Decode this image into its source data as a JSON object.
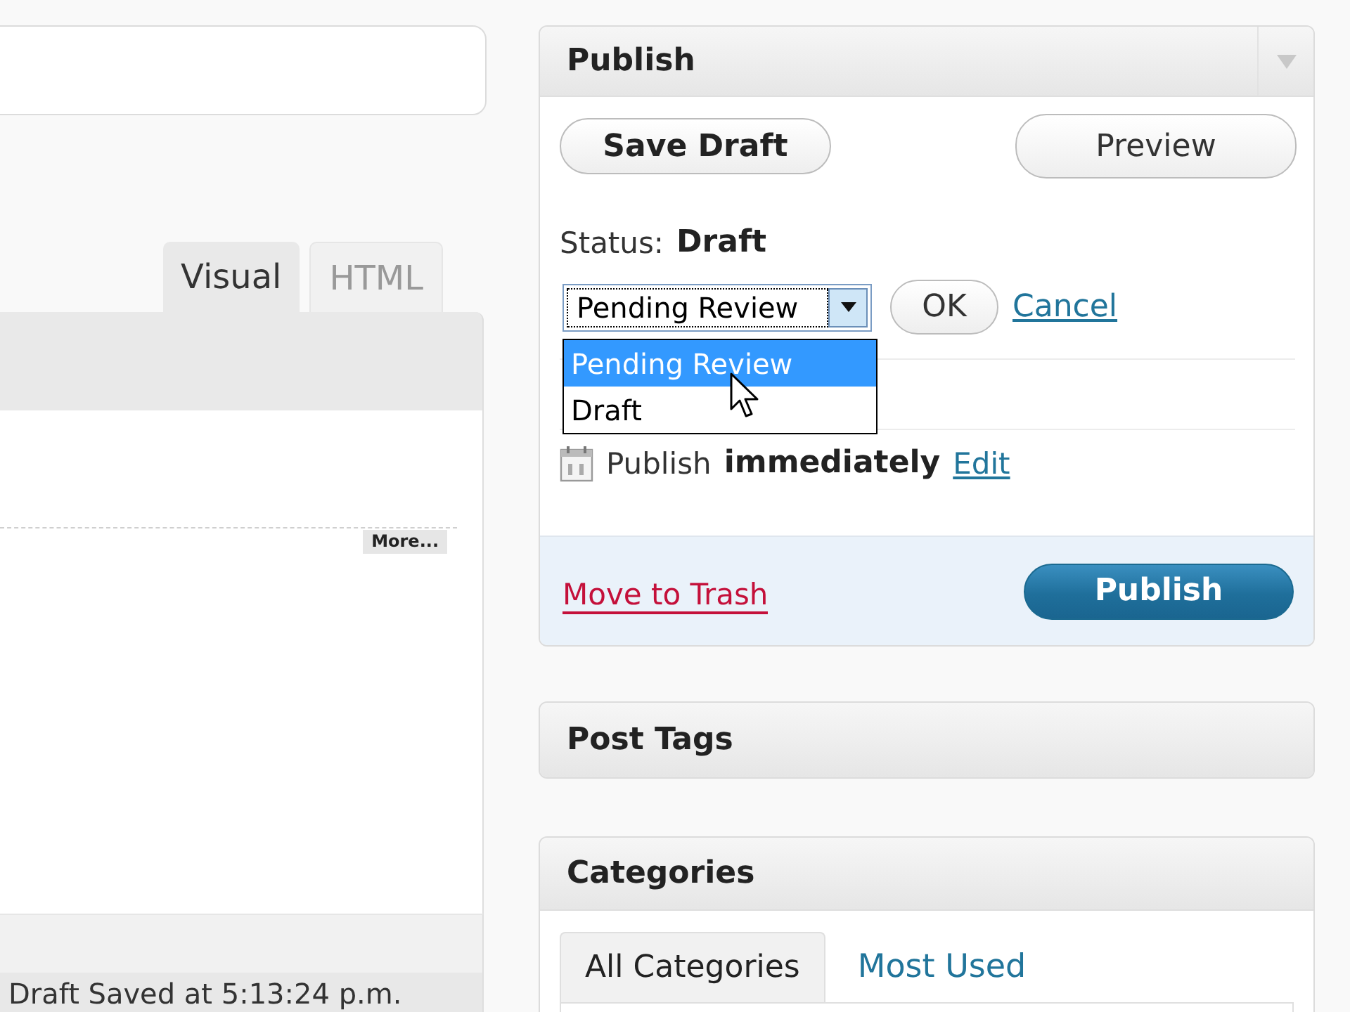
{
  "editor": {
    "tabs": [
      {
        "label": "Visual",
        "selected": true
      },
      {
        "label": "HTML",
        "selected": false
      }
    ],
    "more_tag": "More...",
    "save_status": "Draft Saved at 5:13:24 p.m."
  },
  "publish": {
    "title": "Publish",
    "save_draft_button": "Save Draft",
    "preview_button": "Preview",
    "status": {
      "label": "Status:",
      "value": "Draft"
    },
    "status_select": {
      "value": "Pending Review",
      "expanded": true,
      "options": [
        {
          "label": "Pending Review",
          "selected": true
        },
        {
          "label": "Draft",
          "selected": false
        }
      ]
    },
    "ok_button": "OK",
    "cancel_link": "Cancel",
    "schedule": {
      "label": "Publish",
      "value": "immediately",
      "edit_link": "Edit"
    },
    "trash_link": "Move to Trash",
    "publish_button": "Publish"
  },
  "post_tags": {
    "title": "Post Tags"
  },
  "categories": {
    "title": "Categories",
    "tabs": [
      {
        "label": "All Categories",
        "selected": true
      },
      {
        "label": "Most Used",
        "selected": false
      }
    ]
  }
}
